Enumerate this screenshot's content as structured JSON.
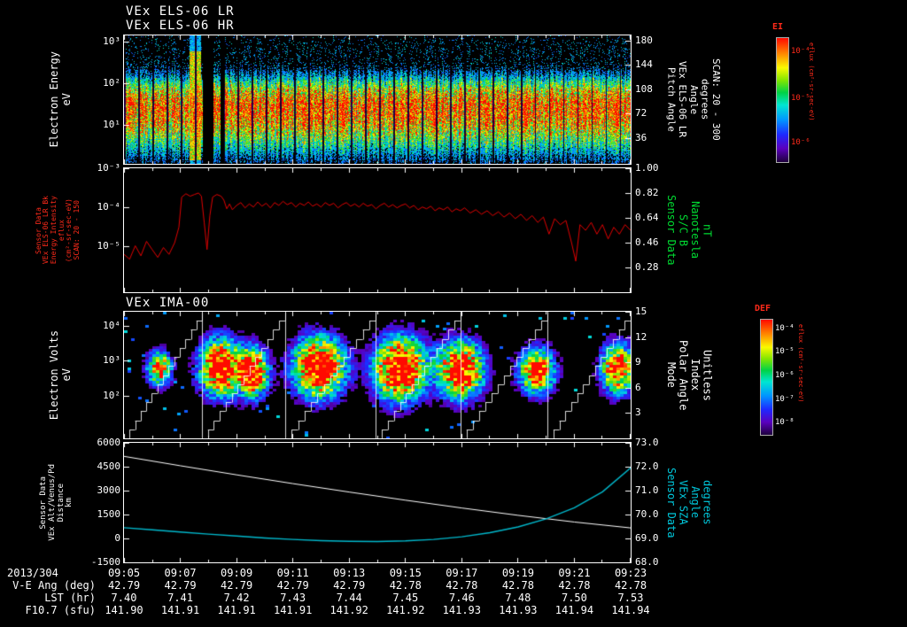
{
  "colors": {
    "background": "#000000",
    "axis": "#ffffff",
    "red_label": "#ff2a1a",
    "green_label": "#00dc32",
    "cyan_label": "#00c8dc",
    "red_line": "#e00000",
    "cyan_line": "#00b8cc",
    "white_line": "#ffffff"
  },
  "chart_data": [
    {
      "id": "els-spectrogram",
      "type": "heatmap",
      "title": [
        "VEx ELS-06 LR",
        "VEx ELS-06 HR"
      ],
      "ylabel": [
        "Electron Energy",
        "eV"
      ],
      "yticks": [
        {
          "label": "10³",
          "frac": 0.048
        },
        {
          "label": "10²",
          "frac": 0.372
        },
        {
          "label": "10¹",
          "frac": 0.697
        }
      ],
      "y2label": [
        "Pitch Angle",
        "VEx ELS-06 LR",
        "Angle",
        "degrees",
        "SCAN: 20 - 300"
      ],
      "y2ticks": [
        {
          "label": "180",
          "frac": 0.041
        },
        {
          "label": "144",
          "frac": 0.231
        },
        {
          "label": "108",
          "frac": 0.421
        },
        {
          "label": "72",
          "frac": 0.61
        },
        {
          "label": "36",
          "frac": 0.8
        }
      ],
      "xrange": [
        "09:05",
        "09:23"
      ],
      "heatmap": {
        "band_center": 0.55,
        "sigma_up": 0.17,
        "sigma_down": 0.26,
        "gap_period": 16,
        "bright_column": [
          0.128,
          0.152
        ],
        "dark_columns": [
          [
            0.155,
            0.176
          ],
          [
            0.19,
            0.197
          ]
        ]
      }
    },
    {
      "id": "els-intensity",
      "type": "line",
      "ylabel": [
        "Sensor Data",
        "VEx ELS-06 LR Bk",
        "Energy Intensity",
        "eflux",
        "(cm²-sr-sec-eV)",
        "SCAN: 20 - 150"
      ],
      "yticks": [
        {
          "label": "10⁻³",
          "frac": 0.0
        },
        {
          "label": "10⁻⁴",
          "frac": 0.3125
        },
        {
          "label": "10⁻⁵",
          "frac": 0.625
        }
      ],
      "ylog_range": [
        -6.2,
        -3
      ],
      "y2label": [
        "Sensor Data",
        "S/C B",
        "Nanotesla",
        "nT"
      ],
      "y2ticks": [
        {
          "label": "1.00",
          "frac": 0.0
        },
        {
          "label": "0.82",
          "frac": 0.2
        },
        {
          "label": "0.64",
          "frac": 0.4
        },
        {
          "label": "0.46",
          "frac": 0.6
        },
        {
          "label": "0.28",
          "frac": 0.8
        }
      ],
      "series": [
        {
          "name": "els_bk_eflux",
          "color": "#e00000",
          "points": [
            [
              0,
              6e-06
            ],
            [
              0.2,
              4.5e-06
            ],
            [
              0.4,
              1e-05
            ],
            [
              0.6,
              5.5e-06
            ],
            [
              0.8,
              1.3e-05
            ],
            [
              1,
              8e-06
            ],
            [
              1.2,
              5e-06
            ],
            [
              1.4,
              9e-06
            ],
            [
              1.6,
              6e-06
            ],
            [
              1.8,
              1.2e-05
            ],
            [
              1.95,
              3e-05
            ],
            [
              2.05,
              0.00018
            ],
            [
              2.2,
              0.00022
            ],
            [
              2.35,
              0.00019
            ],
            [
              2.5,
              0.00021
            ],
            [
              2.65,
              0.00023
            ],
            [
              2.75,
              0.00019
            ],
            [
              2.85,
              4e-05
            ],
            [
              2.95,
              8e-06
            ],
            [
              3.05,
              6e-05
            ],
            [
              3.15,
              0.00018
            ],
            [
              3.3,
              0.00021
            ],
            [
              3.45,
              0.00019
            ],
            [
              3.55,
              0.00015
            ],
            [
              3.65,
              9e-05
            ],
            [
              3.75,
              0.00012
            ],
            [
              3.85,
              8.5e-05
            ],
            [
              4,
              0.00011
            ],
            [
              4.15,
              0.00013
            ],
            [
              4.3,
              9.5e-05
            ],
            [
              4.45,
              0.00012
            ],
            [
              4.6,
              0.0001
            ],
            [
              4.75,
              0.000135
            ],
            [
              4.9,
              0.000105
            ],
            [
              5.05,
              0.000125
            ],
            [
              5.2,
              9.5e-05
            ],
            [
              5.35,
              0.00013
            ],
            [
              5.5,
              0.00011
            ],
            [
              5.65,
              0.00014
            ],
            [
              5.8,
              0.000115
            ],
            [
              5.95,
              0.00013
            ],
            [
              6.1,
              0.0001
            ],
            [
              6.25,
              0.000125
            ],
            [
              6.4,
              0.00011
            ],
            [
              6.55,
              0.000135
            ],
            [
              6.7,
              0.000105
            ],
            [
              6.85,
              0.00012
            ],
            [
              7,
              0.0001
            ],
            [
              7.15,
              0.00013
            ],
            [
              7.3,
              0.00011
            ],
            [
              7.45,
              0.000125
            ],
            [
              7.6,
              9.5e-05
            ],
            [
              7.75,
              0.000115
            ],
            [
              7.9,
              0.00013
            ],
            [
              8.05,
              0.000105
            ],
            [
              8.2,
              0.00012
            ],
            [
              8.35,
              0.0001
            ],
            [
              8.5,
              0.000125
            ],
            [
              8.65,
              0.000105
            ],
            [
              8.8,
              0.000115
            ],
            [
              8.95,
              9e-05
            ],
            [
              9.1,
              0.00011
            ],
            [
              9.25,
              0.000125
            ],
            [
              9.4,
              0.0001
            ],
            [
              9.55,
              0.000115
            ],
            [
              9.7,
              9.5e-05
            ],
            [
              9.85,
              0.00011
            ],
            [
              10,
              0.00012
            ],
            [
              10.15,
              9.5e-05
            ],
            [
              10.3,
              0.00011
            ],
            [
              10.45,
              8.5e-05
            ],
            [
              10.6,
              0.0001
            ],
            [
              10.75,
              9e-05
            ],
            [
              10.9,
              0.000105
            ],
            [
              11.05,
              8e-05
            ],
            [
              11.2,
              9.5e-05
            ],
            [
              11.35,
              8.5e-05
            ],
            [
              11.5,
              0.0001
            ],
            [
              11.65,
              7.5e-05
            ],
            [
              11.8,
              9e-05
            ],
            [
              11.95,
              8e-05
            ],
            [
              12.1,
              9.5e-05
            ],
            [
              12.3,
              7e-05
            ],
            [
              12.5,
              8.5e-05
            ],
            [
              12.7,
              6.5e-05
            ],
            [
              12.9,
              8e-05
            ],
            [
              13.1,
              6e-05
            ],
            [
              13.3,
              7.5e-05
            ],
            [
              13.5,
              5.5e-05
            ],
            [
              13.7,
              7e-05
            ],
            [
              13.9,
              5e-05
            ],
            [
              14.1,
              6.5e-05
            ],
            [
              14.3,
              4.5e-05
            ],
            [
              14.5,
              6e-05
            ],
            [
              14.7,
              4e-05
            ],
            [
              14.9,
              5.5e-05
            ],
            [
              15.1,
              2e-05
            ],
            [
              15.3,
              5e-05
            ],
            [
              15.5,
              3.5e-05
            ],
            [
              15.7,
              4.5e-05
            ],
            [
              15.9,
              1.2e-05
            ],
            [
              16.05,
              4e-06
            ],
            [
              16.2,
              3.5e-05
            ],
            [
              16.4,
              2.5e-05
            ],
            [
              16.6,
              4e-05
            ],
            [
              16.8,
              2e-05
            ],
            [
              17,
              3.5e-05
            ],
            [
              17.2,
              1.5e-05
            ],
            [
              17.4,
              3e-05
            ],
            [
              17.6,
              2e-05
            ],
            [
              17.8,
              3.5e-05
            ],
            [
              18,
              2.5e-05
            ]
          ]
        }
      ]
    },
    {
      "id": "ima-spectrogram",
      "type": "heatmap",
      "title": "VEx IMA-00",
      "ylabel": [
        "Electron Volts",
        "eV"
      ],
      "yticks": [
        {
          "label": "10⁴",
          "frac": 0.112
        },
        {
          "label": "10³",
          "frac": 0.388
        },
        {
          "label": "10²",
          "frac": 0.664
        }
      ],
      "y2label": [
        "Mode",
        "Polar Angle",
        "Index",
        "Unitless"
      ],
      "y2ticks": [
        {
          "label": "15",
          "frac": 0.0
        },
        {
          "label": "12",
          "frac": 0.2
        },
        {
          "label": "9",
          "frac": 0.4
        },
        {
          "label": "6",
          "frac": 0.6
        },
        {
          "label": "3",
          "frac": 0.8
        }
      ],
      "blobs": [
        {
          "cx": 0.07,
          "cy": 0.45,
          "sx": 0.016,
          "sy": 0.09,
          "amp": 0.8
        },
        {
          "cx": 0.19,
          "cy": 0.44,
          "sx": 0.028,
          "sy": 0.15,
          "amp": 1.0
        },
        {
          "cx": 0.255,
          "cy": 0.48,
          "sx": 0.02,
          "sy": 0.13,
          "amp": 0.95
        },
        {
          "cx": 0.385,
          "cy": 0.44,
          "sx": 0.034,
          "sy": 0.16,
          "amp": 1.05
        },
        {
          "cx": 0.545,
          "cy": 0.45,
          "sx": 0.034,
          "sy": 0.17,
          "amp": 1.05
        },
        {
          "cx": 0.665,
          "cy": 0.46,
          "sx": 0.03,
          "sy": 0.15,
          "amp": 1.0
        },
        {
          "cx": 0.815,
          "cy": 0.47,
          "sx": 0.024,
          "sy": 0.12,
          "amp": 0.85
        },
        {
          "cx": 0.975,
          "cy": 0.45,
          "sx": 0.022,
          "sy": 0.13,
          "amp": 0.9
        }
      ],
      "cycle_bounds": [
        0,
        0.154,
        0.318,
        0.497,
        0.664,
        0.836,
        1.0
      ]
    },
    {
      "id": "alt-sza",
      "type": "line",
      "ylabel": [
        "Sensor Data",
        "VEx Alt/Venus/Pd",
        "Distance",
        "km"
      ],
      "yticks": [
        {
          "label": "6000",
          "frac": 0.0
        },
        {
          "label": "4500",
          "frac": 0.2
        },
        {
          "label": "3000",
          "frac": 0.4
        },
        {
          "label": "1500",
          "frac": 0.6
        },
        {
          "label": "0",
          "frac": 0.8
        },
        {
          "label": "-1500",
          "frac": 1.0
        }
      ],
      "yrange": [
        -1500,
        6000
      ],
      "y2label": [
        "Sensor Data",
        "VEx SZA",
        "Angle",
        "degrees"
      ],
      "y2ticks": [
        {
          "label": "73.0",
          "frac": 0.0
        },
        {
          "label": "72.0",
          "frac": 0.2
        },
        {
          "label": "71.0",
          "frac": 0.4
        },
        {
          "label": "70.0",
          "frac": 0.6
        },
        {
          "label": "69.0",
          "frac": 0.8
        },
        {
          "label": "68.0",
          "frac": 1.0
        }
      ],
      "y2range": [
        68,
        73
      ],
      "series": [
        {
          "name": "altitude_km",
          "color": "#ffffff",
          "axis": "left",
          "points": [
            [
              0,
              5150
            ],
            [
              2,
              4560
            ],
            [
              4,
              3990
            ],
            [
              6,
              3440
            ],
            [
              8,
              2910
            ],
            [
              10,
              2400
            ],
            [
              12,
              1910
            ],
            [
              14,
              1450
            ],
            [
              16,
              1030
            ],
            [
              18,
              660
            ]
          ]
        },
        {
          "name": "sza_deg",
          "color": "#00b8cc",
          "axis": "right",
          "points": [
            [
              0,
              69.45
            ],
            [
              1,
              69.36
            ],
            [
              2,
              69.27
            ],
            [
              3,
              69.18
            ],
            [
              4,
              69.1
            ],
            [
              5,
              69.02
            ],
            [
              6,
              68.96
            ],
            [
              7,
              68.91
            ],
            [
              8,
              68.88
            ],
            [
              9,
              68.87
            ],
            [
              10,
              68.9
            ],
            [
              11,
              68.96
            ],
            [
              12,
              69.07
            ],
            [
              13,
              69.24
            ],
            [
              14,
              69.48
            ],
            [
              15,
              69.82
            ],
            [
              16,
              70.28
            ],
            [
              17,
              70.95
            ],
            [
              18,
              71.95
            ]
          ]
        }
      ]
    }
  ],
  "colorbars": [
    {
      "title": "EI",
      "units": "eflux (cm²-sr-sec-eV)",
      "tick_labels": [
        {
          "label": "10⁻⁴",
          "frac": 0.12
        },
        {
          "label": "10⁻⁵",
          "frac": 0.5
        },
        {
          "label": "10⁻⁶",
          "frac": 0.86
        }
      ]
    },
    {
      "title": "DEF",
      "units": "eflux (cm²-sr-sec-eV)",
      "tick_labels": [
        {
          "label": "10⁻⁴",
          "frac": 0.09
        },
        {
          "label": "10⁻⁵",
          "frac": 0.295
        },
        {
          "label": "10⁻⁶",
          "frac": 0.5
        },
        {
          "label": "10⁻⁷",
          "frac": 0.705
        },
        {
          "label": "10⁻⁸",
          "frac": 0.91
        }
      ]
    }
  ],
  "time_axis": {
    "date_label": "2013/304",
    "tick_labels": [
      "09:05",
      "09:07",
      "09:09",
      "09:11",
      "09:13",
      "09:15",
      "09:17",
      "09:19",
      "09:21",
      "09:23"
    ]
  },
  "table": {
    "rows": [
      {
        "label": "V-E Ang (deg)",
        "values": [
          "42.79",
          "42.79",
          "42.79",
          "42.79",
          "42.79",
          "42.78",
          "42.78",
          "42.78",
          "42.78",
          "42.78"
        ]
      },
      {
        "label": "LST (hr)",
        "values": [
          "7.40",
          "7.41",
          "7.42",
          "7.43",
          "7.44",
          "7.45",
          "7.46",
          "7.48",
          "7.50",
          "7.53"
        ]
      },
      {
        "label": "F10.7 (sfu)",
        "values": [
          "141.90",
          "141.91",
          "141.91",
          "141.91",
          "141.92",
          "141.92",
          "141.93",
          "141.93",
          "141.94",
          "141.94"
        ]
      }
    ]
  }
}
